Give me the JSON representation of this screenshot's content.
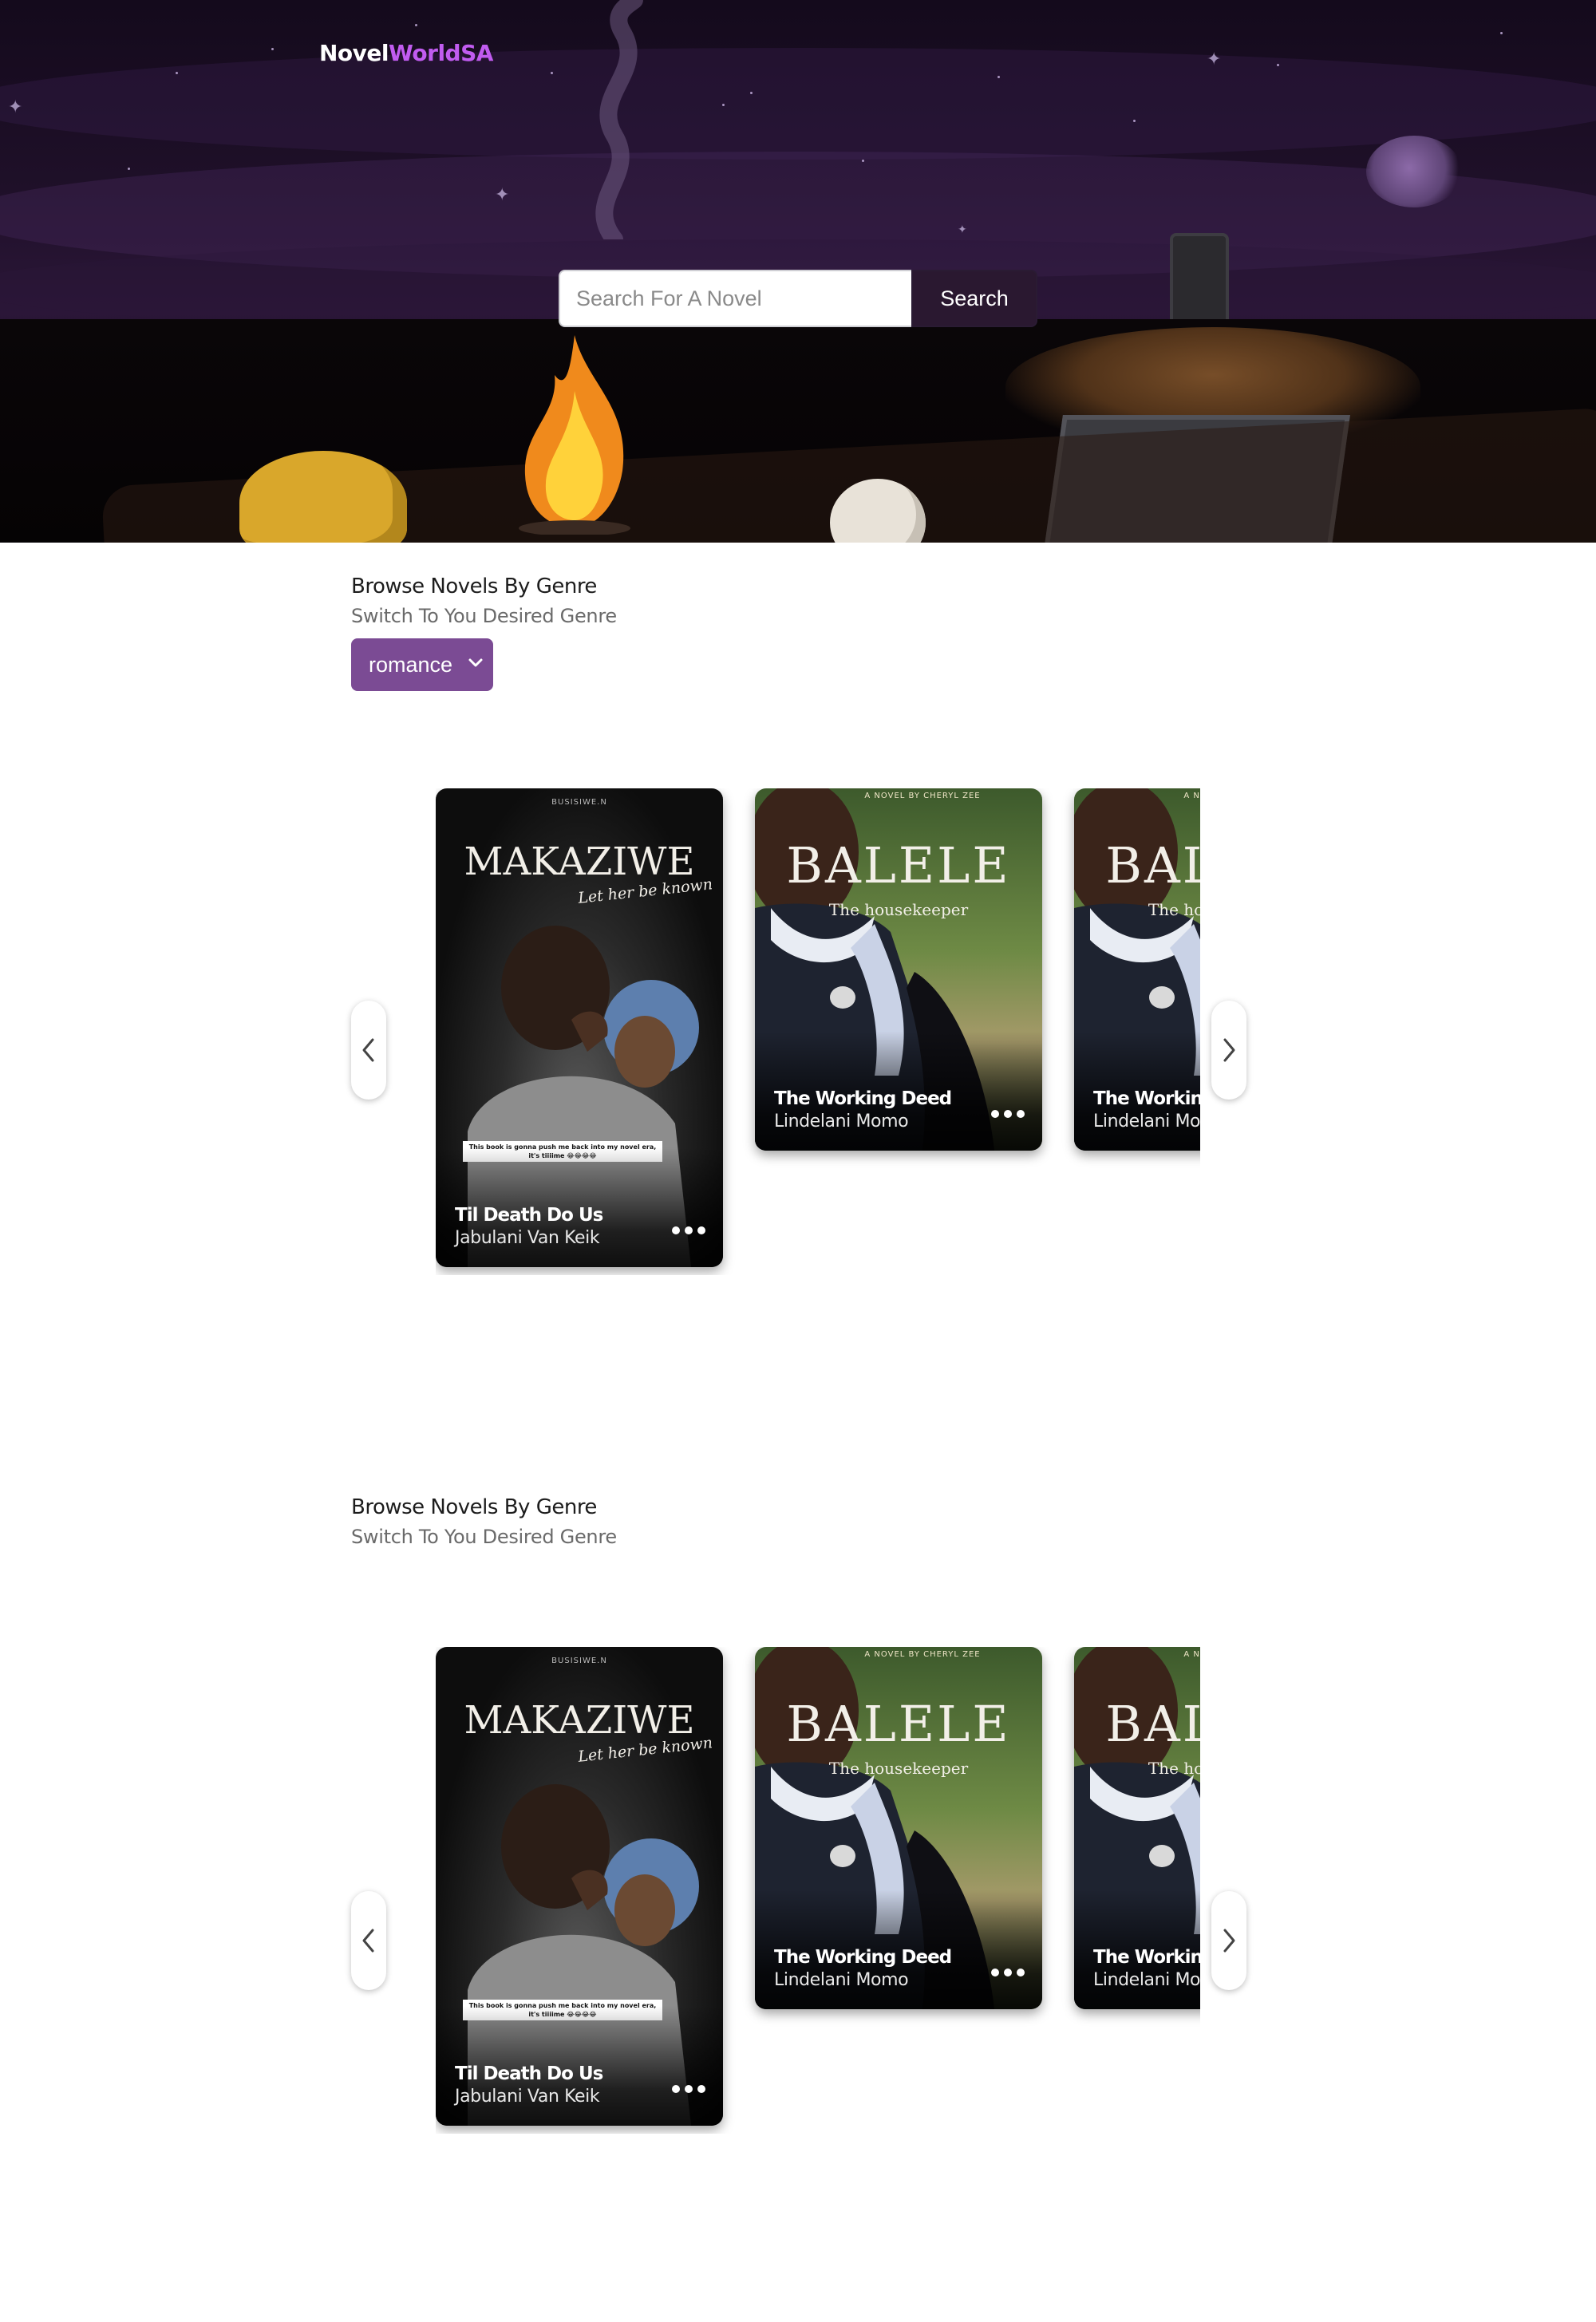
{
  "brand": {
    "part1": "Novel",
    "part2": "WorldSA"
  },
  "search": {
    "placeholder": "Search For A Novel",
    "button_label": "Search"
  },
  "sections": [
    {
      "title": "Browse Novels By Genre",
      "subtitle": "Switch To You Desired Genre",
      "genre_selected": "romance"
    },
    {
      "title": "Browse Novels By Genre",
      "subtitle": "Switch To You Desired Genre"
    }
  ],
  "novels": [
    {
      "title": "Til Death Do Us",
      "author": "Jabulani Van Keik",
      "cover": {
        "author_line": "BUSISIWE.N",
        "main_title": "MAKAZIWE",
        "tagline": "Let her be known",
        "banner": "This book is gonna push me back into my novel era, it's tiiiime 😂😂😂😂"
      }
    },
    {
      "title": "The Working Deed",
      "author": "Lindelani Momo",
      "cover": {
        "author_line": "A NOVEL BY CHERYL ZEE",
        "main_title": "BALELE",
        "tagline": "The housekeeper"
      }
    },
    {
      "title": "The Working Deed",
      "author": "Lindelani Momo",
      "cover": {
        "author_line": "A NOVEL BY CHERYL ZEE",
        "main_title": "BALELE",
        "tagline": "The housekeeper"
      }
    }
  ],
  "icons": {
    "prev": "chevron-left-icon",
    "next": "chevron-right-icon",
    "more": "more-dots-icon",
    "dropdown": "chevron-down-icon"
  },
  "colors": {
    "brand_accent": "#c15cf0",
    "genre_select_bg": "#7b4b94",
    "search_button_bg": "#2a1830"
  }
}
